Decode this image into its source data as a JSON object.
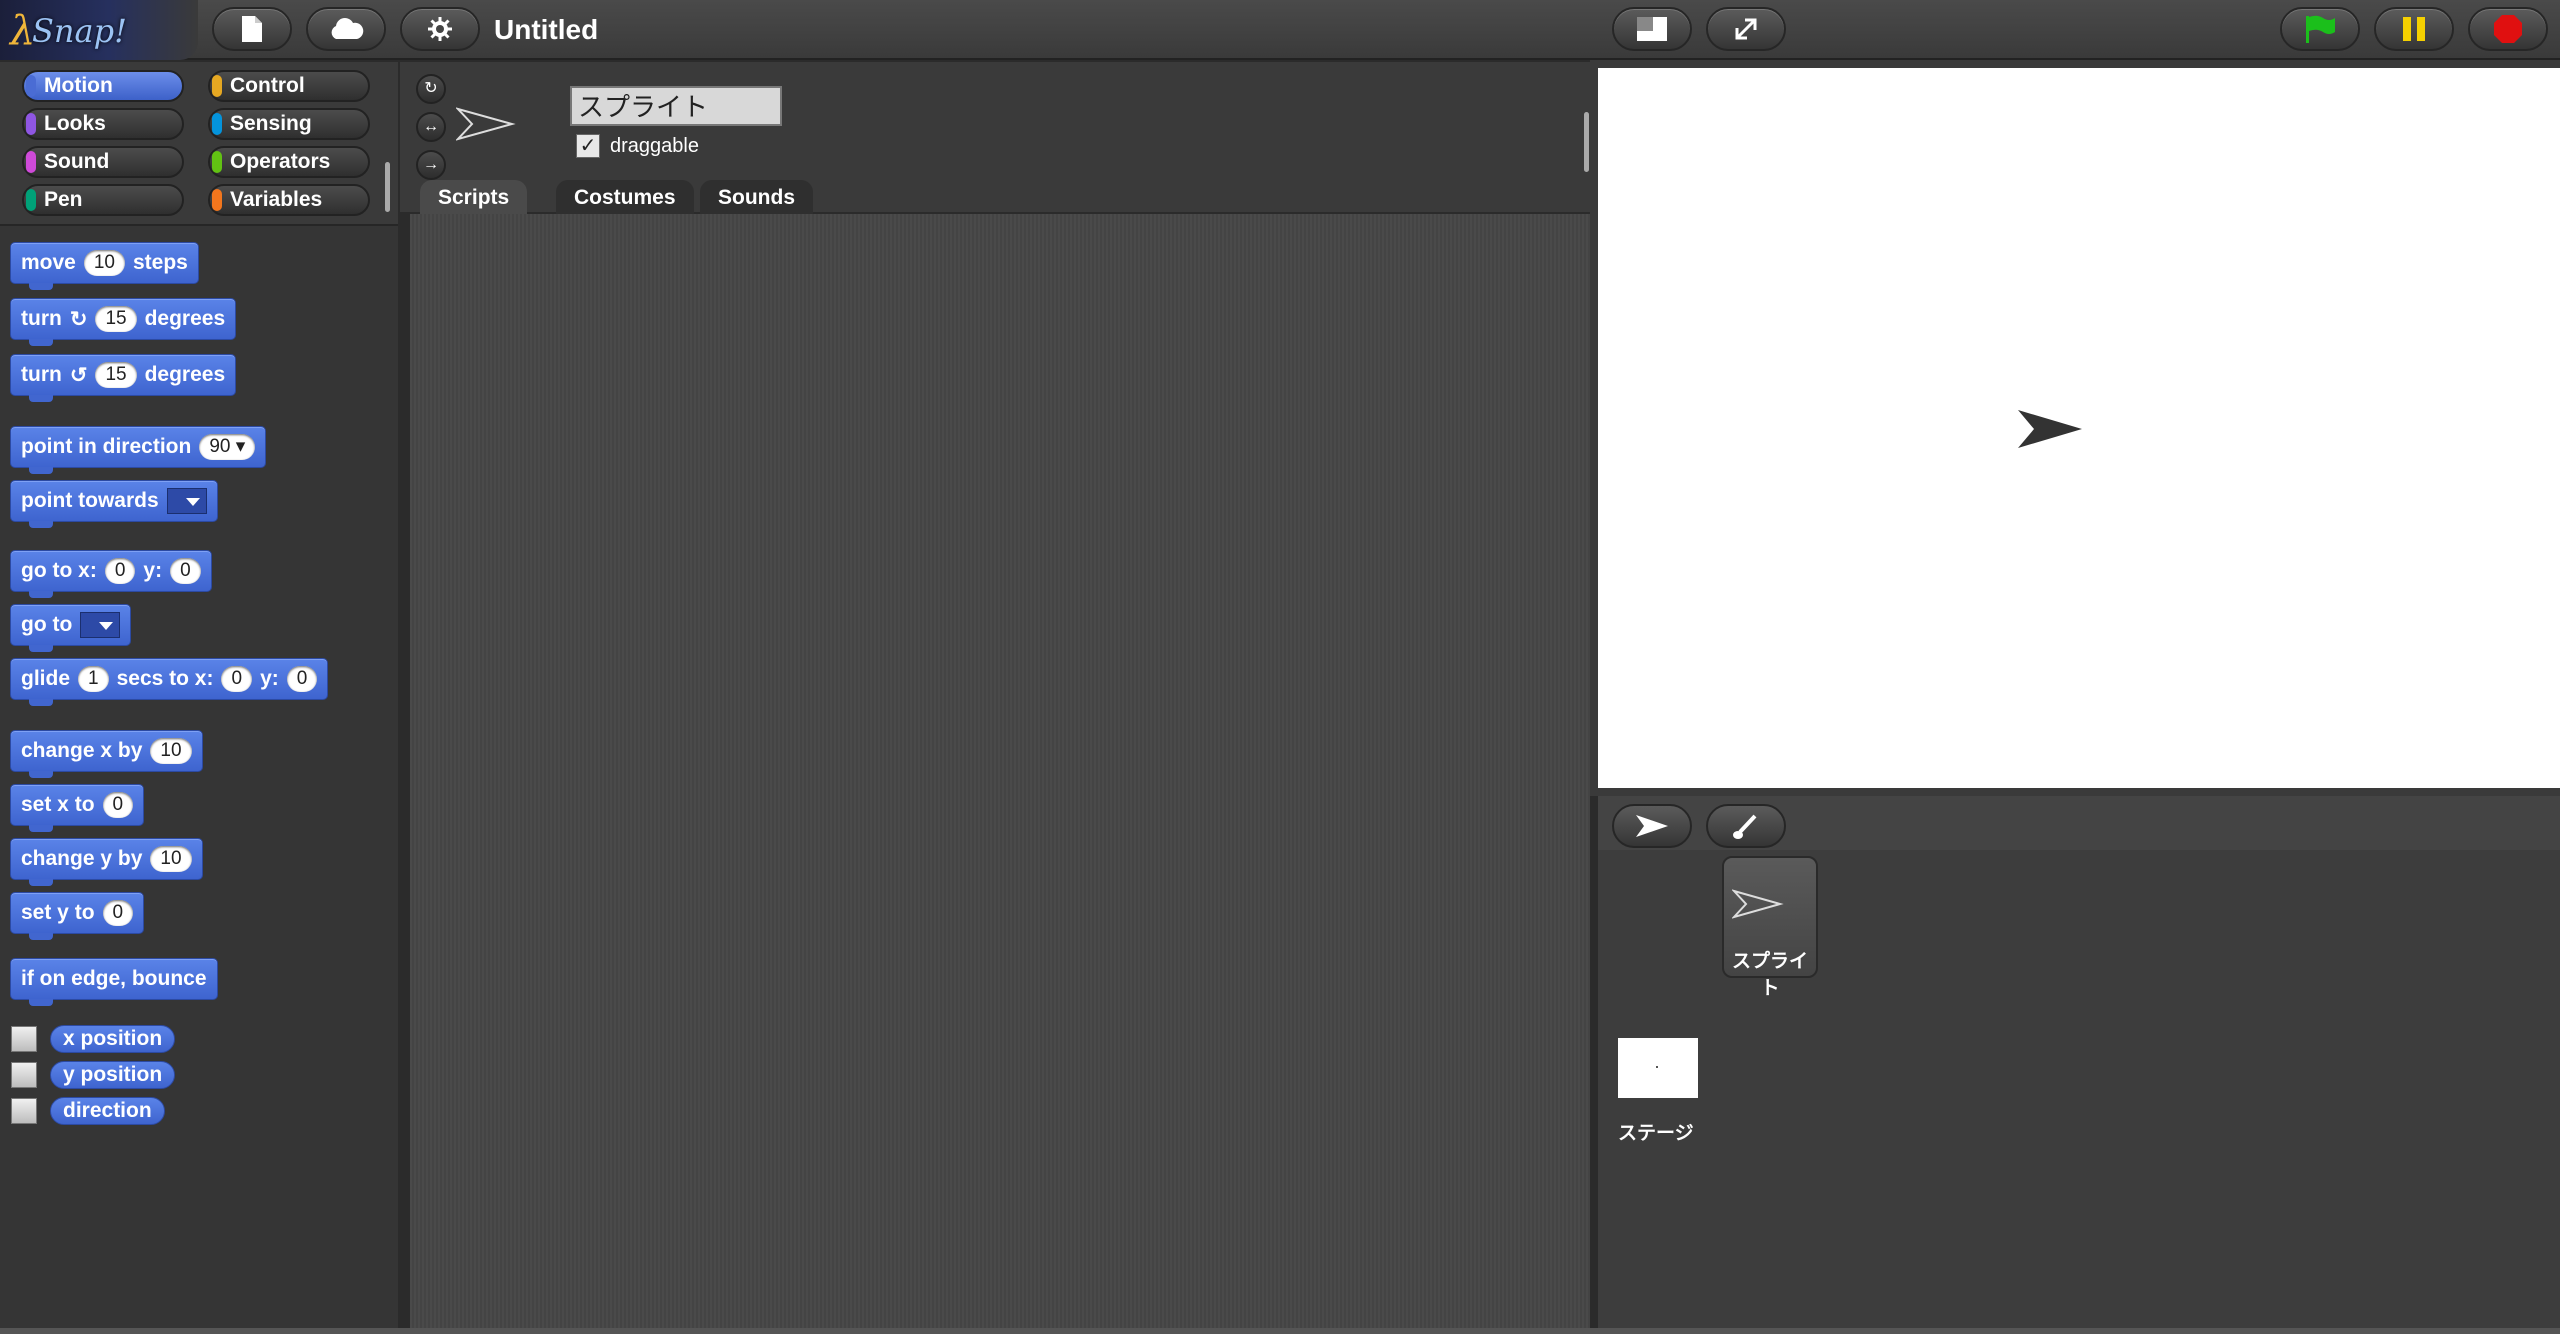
{
  "app": {
    "logo": "Snap!",
    "project_title": "Untitled"
  },
  "toolbar": {
    "file_icon": "page-icon",
    "cloud_icon": "cloud-icon",
    "settings_icon": "gear-icon",
    "stage_size_icon": "stage-size-icon",
    "fullscreen_icon": "expand-icon",
    "green_flag_icon": "green-flag-icon",
    "pause_icon": "pause-icon",
    "stop_icon": "stop-icon",
    "flag_color": "#1bbf1b",
    "pause_color": "#f5d000",
    "stop_color": "#e01010"
  },
  "categories": [
    {
      "label": "Motion",
      "color": "#4a6cd4",
      "active": true
    },
    {
      "label": "Control",
      "color": "#e6a822"
    },
    {
      "label": "Looks",
      "color": "#8f56e3"
    },
    {
      "label": "Sensing",
      "color": "#0494dc"
    },
    {
      "label": "Sound",
      "color": "#cf4ad9"
    },
    {
      "label": "Operators",
      "color": "#62c213"
    },
    {
      "label": "Pen",
      "color": "#00a178"
    },
    {
      "label": "Variables",
      "color": "#f3761d"
    }
  ],
  "blocks": {
    "move": {
      "a": "move",
      "v": "10",
      "b": "steps"
    },
    "turn_cw": {
      "a": "turn",
      "v": "15",
      "b": "degrees"
    },
    "turn_ccw": {
      "a": "turn",
      "v": "15",
      "b": "degrees"
    },
    "point_dir": {
      "a": "point in direction",
      "v": "90"
    },
    "point_towards": {
      "a": "point towards"
    },
    "go_to_xy": {
      "a": "go to x:",
      "v1": "0",
      "b": "y:",
      "v2": "0"
    },
    "go_to": {
      "a": "go to"
    },
    "glide": {
      "a": "glide",
      "v1": "1",
      "b": "secs to x:",
      "v2": "0",
      "c": "y:",
      "v3": "0"
    },
    "change_x": {
      "a": "change x by",
      "v": "10"
    },
    "set_x": {
      "a": "set x to",
      "v": "0"
    },
    "change_y": {
      "a": "change y by",
      "v": "10"
    },
    "set_y": {
      "a": "set y to",
      "v": "0"
    },
    "bounce": {
      "a": "if on edge, bounce"
    },
    "x_position": "x position",
    "y_position": "y position",
    "direction": "direction"
  },
  "sprite": {
    "name": "スプライト",
    "draggable_label": "draggable",
    "draggable": true
  },
  "tabs": [
    "Scripts",
    "Costumes",
    "Sounds"
  ],
  "corral": {
    "sprite_label": "スプライト",
    "stage_label": "ステージ",
    "turtle_icon": "arrow-icon",
    "paint_icon": "brush-icon"
  }
}
